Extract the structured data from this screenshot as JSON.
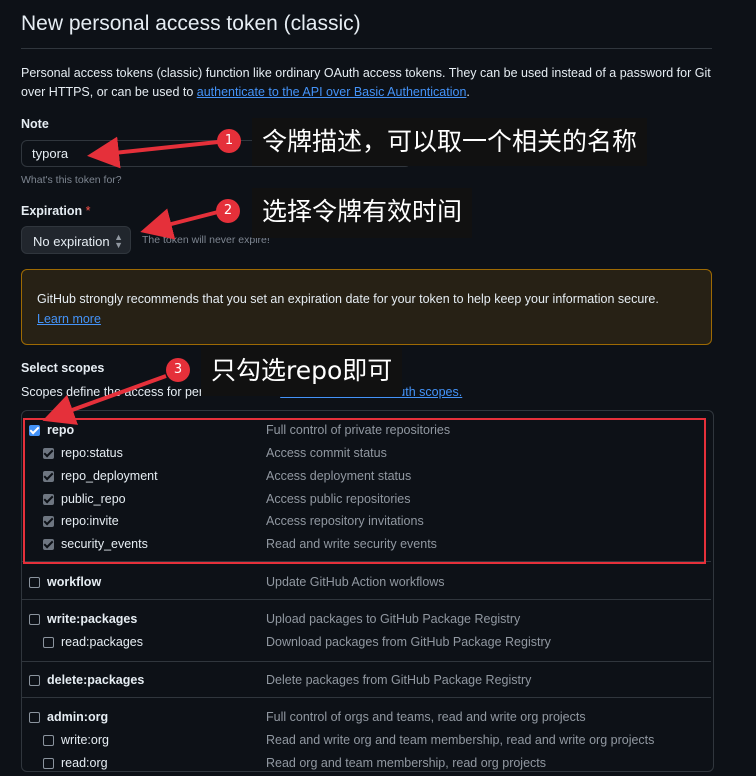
{
  "page": {
    "title": "New personal access token (classic)",
    "intro_text": "Personal access tokens (classic) function like ordinary OAuth access tokens. They can be used instead of a password for Git over HTTPS, or can be used to ",
    "intro_link": "authenticate to the API over Basic Authentication",
    "intro_end": "."
  },
  "note": {
    "label": "Note",
    "value": "typora",
    "hint": "What's this token for?"
  },
  "expiration": {
    "label": "Expiration",
    "required_mark": "*",
    "selected": "No expiration",
    "hint": "The token will never expire!"
  },
  "warning": {
    "text": "GitHub strongly recommends that you set an expiration date for your token to help keep your information secure.",
    "link": "Learn more"
  },
  "scopes": {
    "label": "Select scopes",
    "desc": "Scopes define the access for personal tokens. ",
    "desc_link": "Read more about OAuth scopes.",
    "rows": [
      {
        "name": "repo",
        "desc": "Full control of private repositories",
        "checked": true,
        "parent": true
      },
      {
        "name": "repo:status",
        "desc": "Access commit status",
        "checked": true,
        "parent": false
      },
      {
        "name": "repo_deployment",
        "desc": "Access deployment status",
        "checked": true,
        "parent": false
      },
      {
        "name": "public_repo",
        "desc": "Access public repositories",
        "checked": true,
        "parent": false
      },
      {
        "name": "repo:invite",
        "desc": "Access repository invitations",
        "checked": true,
        "parent": false
      },
      {
        "name": "security_events",
        "desc": "Read and write security events",
        "checked": true,
        "parent": false
      },
      {
        "name": "workflow",
        "desc": "Update GitHub Action workflows",
        "checked": false,
        "parent": true
      },
      {
        "name": "write:packages",
        "desc": "Upload packages to GitHub Package Registry",
        "checked": false,
        "parent": true
      },
      {
        "name": "read:packages",
        "desc": "Download packages from GitHub Package Registry",
        "checked": false,
        "parent": false
      },
      {
        "name": "delete:packages",
        "desc": "Delete packages from GitHub Package Registry",
        "checked": false,
        "parent": true
      },
      {
        "name": "admin:org",
        "desc": "Full control of orgs and teams, read and write org projects",
        "checked": false,
        "parent": true
      },
      {
        "name": "write:org",
        "desc": "Read and write org and team membership, read and write org projects",
        "checked": false,
        "parent": false
      },
      {
        "name": "read:org",
        "desc": "Read org and team membership, read org projects",
        "checked": false,
        "parent": false
      }
    ]
  },
  "annotations": [
    {
      "number": "1",
      "text": "令牌描述，可以取一个相关的名称"
    },
    {
      "number": "2",
      "text": "选择令牌有效时间"
    },
    {
      "number": "3",
      "text": "只勾选repo即可"
    }
  ],
  "colors": {
    "background": "#0d1117",
    "link": "#4493f8",
    "annotation_red": "#e5303a",
    "warning_border": "#9e6a03"
  }
}
